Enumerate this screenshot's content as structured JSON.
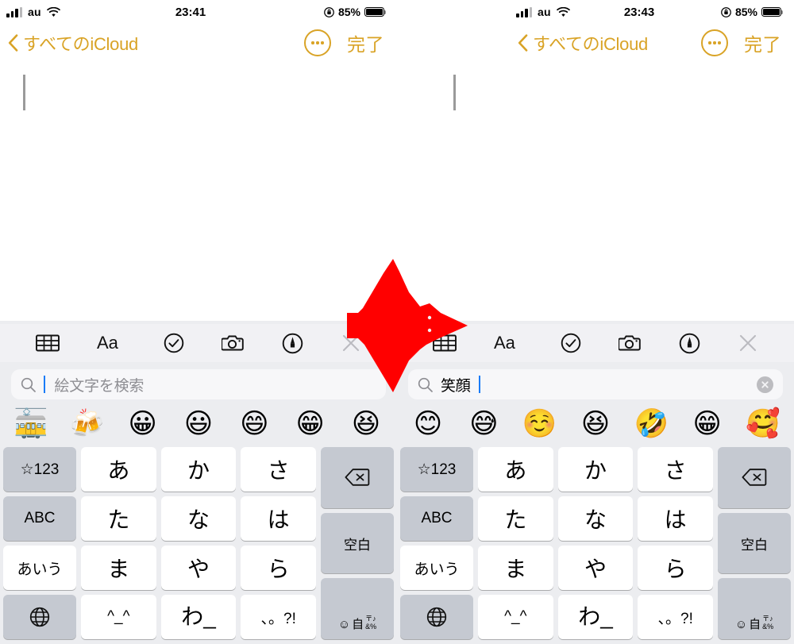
{
  "meta": {
    "app": "Apple Notes",
    "accent_gold": "#D9A326",
    "arrow_color": "#FF0000",
    "keyboard_bg": "#ECEDF0",
    "key_white": "#FFFFFF",
    "key_gray": "#C5C9D1",
    "caret_blue": "#1A7CF7"
  },
  "panels": [
    {
      "id": "left",
      "status": {
        "signal_icon": "cellular-signal-icon",
        "carrier": "au",
        "wifi_icon": "wifi-icon",
        "time": "23:41",
        "rotation_lock_icon": "rotation-lock-icon",
        "battery_percent": "85%",
        "battery_icon": "battery-full-icon"
      },
      "nav": {
        "back_icon": "chevron-left-icon",
        "back_label": "すべてのiCloud",
        "more_icon": "more-ellipsis-icon",
        "done_label": "完了"
      },
      "note": {
        "caret": "text-cursor"
      },
      "toolbar": [
        {
          "name": "table-icon",
          "label": ""
        },
        {
          "name": "text-format-icon",
          "label": "Aa"
        },
        {
          "name": "checklist-icon",
          "label": ""
        },
        {
          "name": "camera-icon",
          "label": ""
        },
        {
          "name": "markup-pen-icon",
          "label": ""
        },
        {
          "name": "close-icon",
          "label": ""
        }
      ],
      "search": {
        "icon": "search-icon",
        "value": "",
        "placeholder": "絵文字を検索",
        "has_clear_button": false,
        "caret_position": "before-text"
      },
      "emoji_suggestions": [
        "🚋",
        "🍻",
        "😀",
        "😃",
        "😄",
        "😁",
        "😆"
      ],
      "keyboard": {
        "row1": [
          "☆123",
          "あ",
          "か",
          "さ"
        ],
        "row1_right": "delete-icon",
        "row2": [
          "ABC",
          "た",
          "な",
          "は"
        ],
        "row2_right": "空白",
        "row3": [
          "あいう",
          "ま",
          "や",
          "ら"
        ],
        "row4": [
          "globe-icon",
          "^_^",
          "わ_",
          "、。?!"
        ],
        "return_key": "emoji-symbols-return-icon"
      }
    },
    {
      "id": "right",
      "status": {
        "signal_icon": "cellular-signal-icon",
        "carrier": "au",
        "wifi_icon": "wifi-icon",
        "time": "23:43",
        "rotation_lock_icon": "rotation-lock-icon",
        "battery_percent": "85%",
        "battery_icon": "battery-full-icon"
      },
      "nav": {
        "back_icon": "chevron-left-icon",
        "back_label": "すべてのiCloud",
        "more_icon": "more-ellipsis-icon",
        "done_label": "完了"
      },
      "note": {
        "caret": "text-cursor"
      },
      "toolbar": [
        {
          "name": "table-icon",
          "label": ""
        },
        {
          "name": "text-format-icon",
          "label": "Aa"
        },
        {
          "name": "checklist-icon",
          "label": ""
        },
        {
          "name": "camera-icon",
          "label": ""
        },
        {
          "name": "markup-pen-icon",
          "label": ""
        },
        {
          "name": "close-icon",
          "label": ""
        }
      ],
      "search": {
        "icon": "search-icon",
        "value": "笑顔",
        "placeholder": "絵文字を検索",
        "has_clear_button": true,
        "clear_icon": "clear-circle-icon",
        "caret_position": "after-text"
      },
      "emoji_suggestions": [
        "😊",
        "😅",
        "☺️",
        "😆",
        "🤣",
        "😁",
        "🥰"
      ],
      "keyboard": {
        "row1": [
          "☆123",
          "あ",
          "か",
          "さ"
        ],
        "row1_right": "delete-icon",
        "row2": [
          "ABC",
          "た",
          "な",
          "は"
        ],
        "row2_right": "空白",
        "row3": [
          "あいう",
          "ま",
          "や",
          "ら"
        ],
        "row4": [
          "globe-icon",
          "^_^",
          "わ_",
          "、。?!"
        ],
        "return_key": "emoji-symbols-return-icon"
      }
    }
  ],
  "annotation": {
    "arrow_icon": "red-right-arrow",
    "direction": "right"
  }
}
